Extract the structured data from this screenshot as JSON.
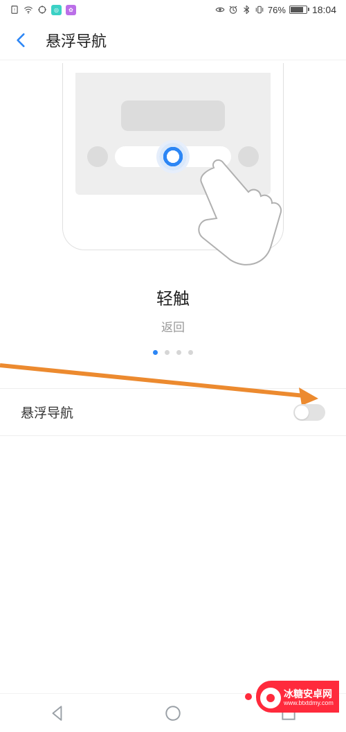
{
  "status": {
    "battery_pct": "76%",
    "time": "18:04"
  },
  "header": {
    "title": "悬浮导航"
  },
  "caption": {
    "title": "轻触",
    "subtitle": "返回"
  },
  "setting": {
    "label": "悬浮导航",
    "enabled": false
  },
  "watermark": {
    "name": "冰糖安卓网",
    "url": "www.btxtdmy.com"
  }
}
